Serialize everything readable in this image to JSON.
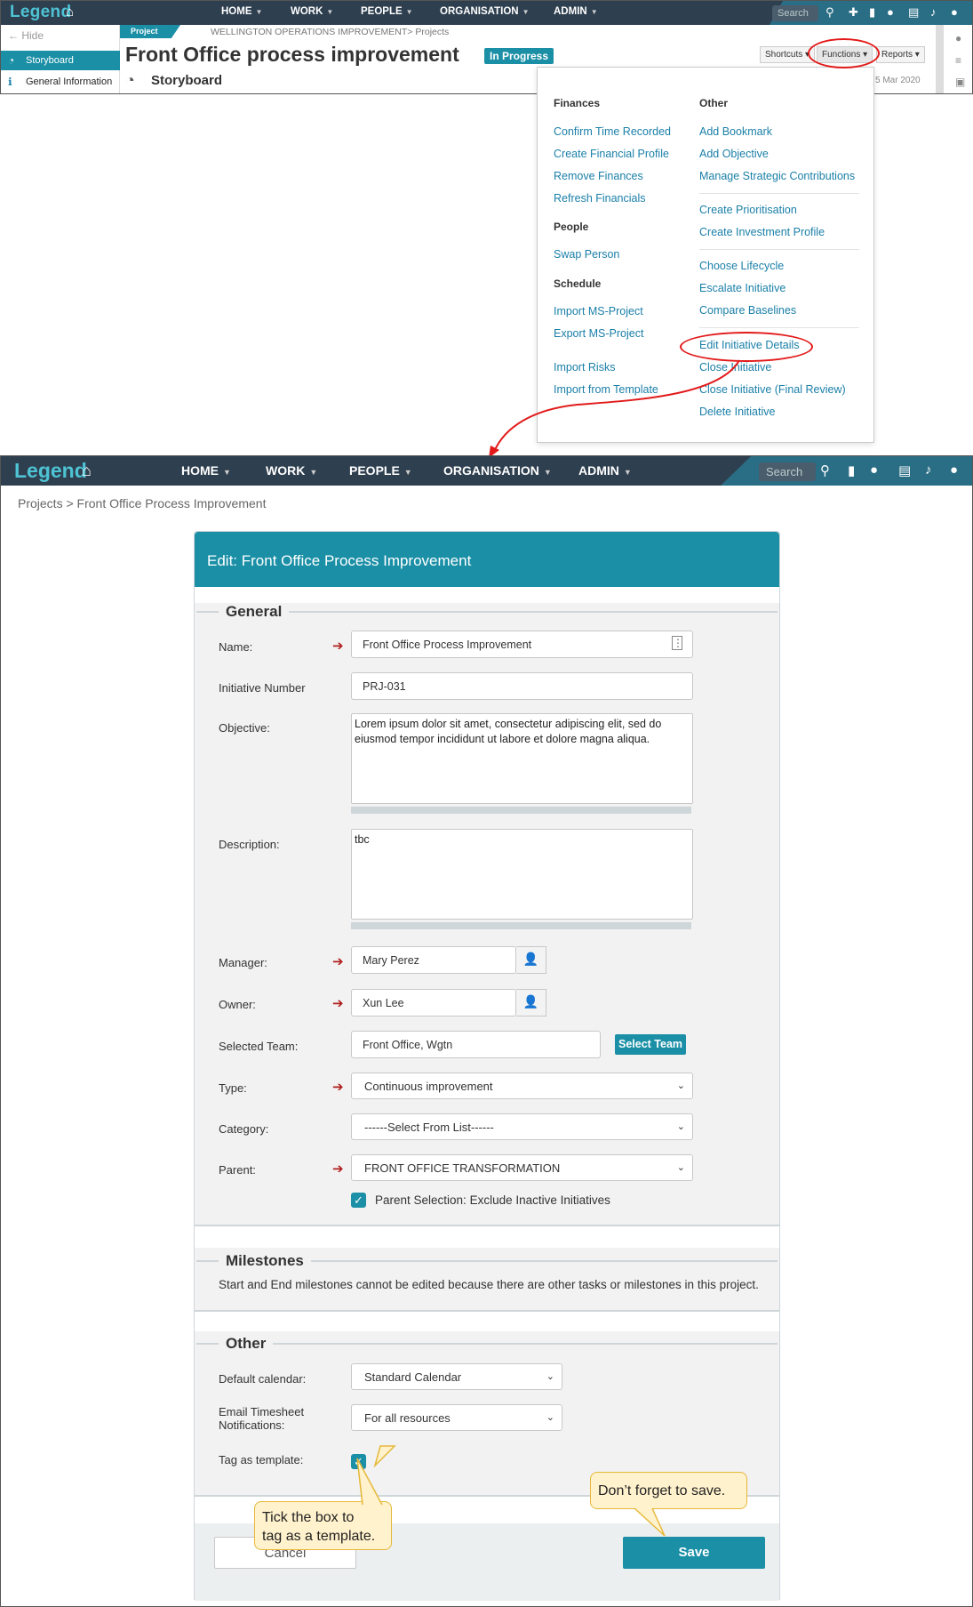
{
  "top": {
    "logo": "Legend",
    "nav": [
      "HOME",
      "WORK",
      "PEOPLE",
      "ORGANISATION",
      "ADMIN"
    ],
    "search_placeholder": "Search",
    "sidebar": {
      "hide": "Hide",
      "items": [
        "Storyboard",
        "General Information"
      ]
    },
    "project_tab": "Project",
    "breadcrumb": "WELLINGTON OPERATIONS IMPROVEMENT> Projects",
    "title": "Front Office process improvement",
    "status": "In Progress",
    "subtitle": "Storyboard",
    "toolbar": {
      "shortcuts": "Shortcuts",
      "functions": "Functions",
      "reports": "Reports"
    },
    "date": "5 Mar 2020",
    "functions_menu": {
      "left": [
        {
          "heading": "Finances",
          "items": [
            "Confirm Time Recorded",
            "Create Financial Profile",
            "Remove Finances",
            "Refresh Financials"
          ]
        },
        {
          "heading": "People",
          "items": [
            "Swap Person"
          ]
        },
        {
          "heading": "Schedule",
          "items": [
            "Import MS-Project",
            "Export MS-Project",
            "Import Risks",
            "Import from Template"
          ]
        }
      ],
      "right_heading": "Other",
      "right_groups": [
        [
          "Add Bookmark",
          "Add Objective",
          "Manage Strategic Contributions"
        ],
        [
          "Create Prioritisation",
          "Create Investment Profile"
        ],
        [
          "Choose Lifecycle",
          "Escalate Initiative",
          "Compare Baselines"
        ],
        [
          "Edit Initiative Details",
          "Close Initiative",
          "Close Initiative (Final Review)",
          "Delete Initiative"
        ]
      ]
    }
  },
  "bottom": {
    "logo": "Legend",
    "nav": [
      "HOME",
      "WORK",
      "PEOPLE",
      "ORGANISATION",
      "ADMIN"
    ],
    "search_placeholder": "Search",
    "breadcrumb": "Projects > Front Office Process Improvement",
    "form_title": "Edit: Front Office Process Improvement",
    "general": {
      "title": "General",
      "name_label": "Name:",
      "name_value": "Front Office Process Improvement",
      "number_label": "Initiative Number",
      "number_value": "PRJ-031",
      "objective_label": "Objective:",
      "objective_value": "Lorem ipsum dolor sit amet, consectetur adipiscing elit, sed do eiusmod tempor incididunt ut labore et dolore magna aliqua.",
      "description_label": "Description:",
      "description_value": "tbc",
      "manager_label": "Manager:",
      "manager_value": "Mary Perez",
      "owner_label": "Owner:",
      "owner_value": "Xun Lee",
      "team_label": "Selected Team:",
      "team_value": "Front Office, Wgtn",
      "select_team": "Select Team",
      "type_label": "Type:",
      "type_value": "Continuous improvement",
      "category_label": "Category:",
      "category_value": "------Select From List------",
      "parent_label": "Parent:",
      "parent_value": "FRONT OFFICE TRANSFORMATION",
      "exclude_label": "Parent Selection: Exclude Inactive Initiatives"
    },
    "milestones": {
      "title": "Milestones",
      "text": "Start and End milestones cannot be edited because there are other tasks or milestones in this project."
    },
    "other": {
      "title": "Other",
      "calendar_label": "Default calendar:",
      "calendar_value": "Standard Calendar",
      "email_label_1": "Email Timesheet",
      "email_label_2": "Notifications:",
      "email_value": "For all resources",
      "template_label": "Tag as template:"
    },
    "cancel": "Cancel",
    "save": "Save"
  },
  "callouts": {
    "save": "Don’t forget to save.",
    "template_1": "Tick the box to",
    "template_2": "tag as a template."
  },
  "colors": {
    "accent": "#1a8fa6",
    "nav": "#2e3f4f",
    "annotation": "#e21a1a",
    "callout": "#fff2cc"
  }
}
